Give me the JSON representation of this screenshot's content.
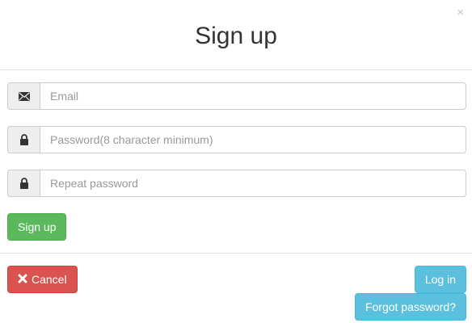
{
  "modal": {
    "title": "Sign up",
    "close_glyph": "×",
    "close_icon": "close-icon"
  },
  "form": {
    "email": {
      "placeholder": "Email",
      "icon": "envelope-icon",
      "value": ""
    },
    "password": {
      "placeholder": "Password(8 character minimum)",
      "icon": "lock-icon",
      "value": ""
    },
    "repeat_password": {
      "placeholder": "Repeat password",
      "icon": "lock-icon",
      "value": ""
    },
    "submit_label": "Sign up"
  },
  "footer": {
    "cancel_label": "Cancel",
    "cancel_icon": "remove-icon",
    "login_label": "Log in",
    "forgot_label": "Forgot password?"
  },
  "colors": {
    "success": "#5cb85c",
    "danger": "#d9534f",
    "info": "#5bc0de",
    "addon_bg": "#eeeeee"
  }
}
